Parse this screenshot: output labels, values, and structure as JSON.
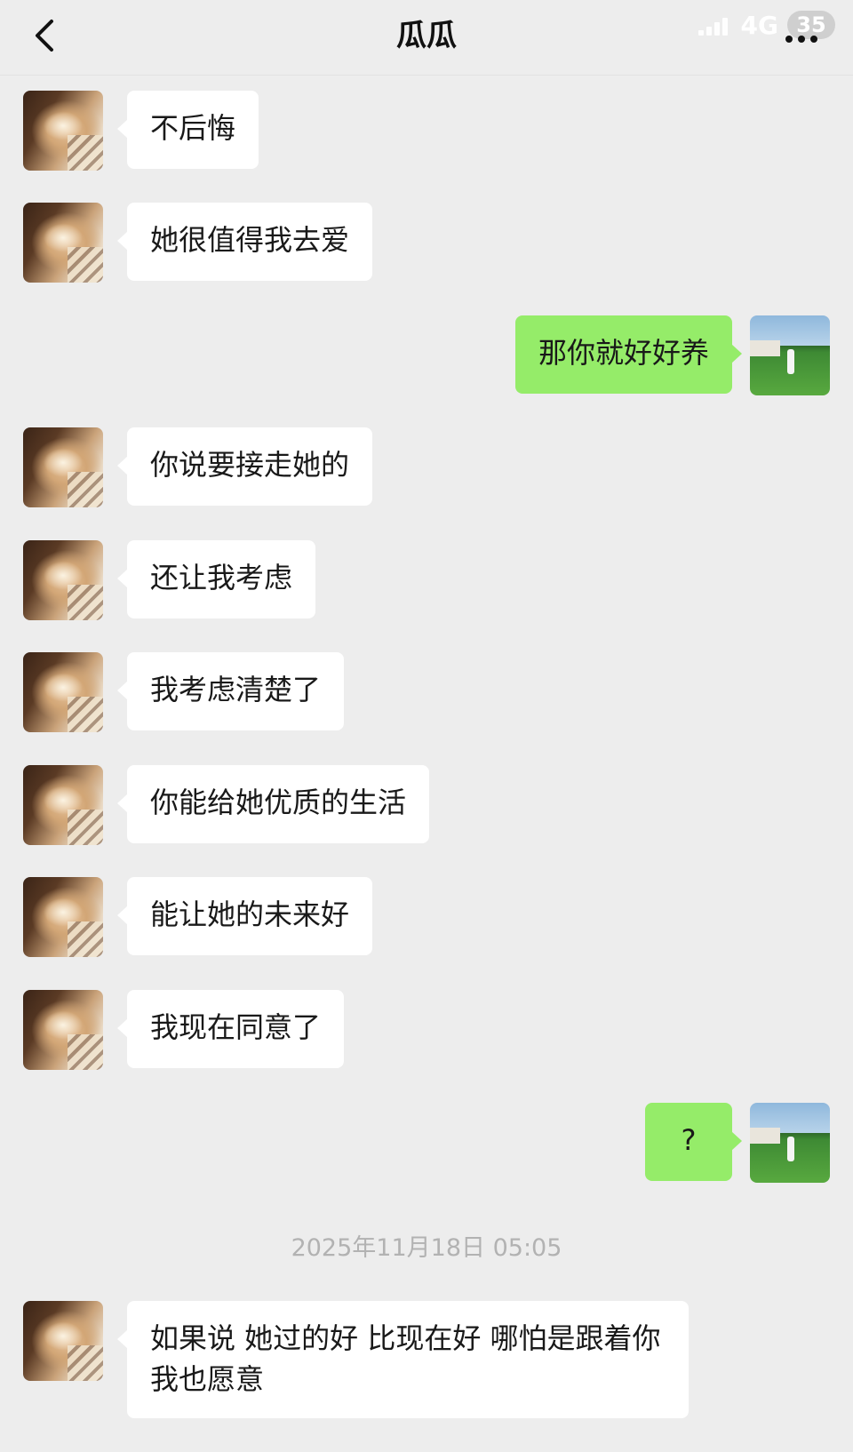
{
  "header": {
    "title": "瓜瓜",
    "network": "4G",
    "battery": "35"
  },
  "messages": [
    {
      "side": "left",
      "text": "不后悔"
    },
    {
      "side": "left",
      "text": "她很值得我去爱"
    },
    {
      "side": "right",
      "text": "那你就好好养"
    },
    {
      "side": "left",
      "text": "你说要接走她的"
    },
    {
      "side": "left",
      "text": "还让我考虑"
    },
    {
      "side": "left",
      "text": "我考虑清楚了"
    },
    {
      "side": "left",
      "text": "你能给她优质的生活"
    },
    {
      "side": "left",
      "text": "能让她的未来好"
    },
    {
      "side": "left",
      "text": "我现在同意了"
    },
    {
      "side": "right",
      "text": "?"
    },
    {
      "side": "left",
      "text": "如果说 她过的好 比现在好 哪怕是跟着你 我也愿意"
    }
  ],
  "timestamp": "2025年11月18日 05:05"
}
